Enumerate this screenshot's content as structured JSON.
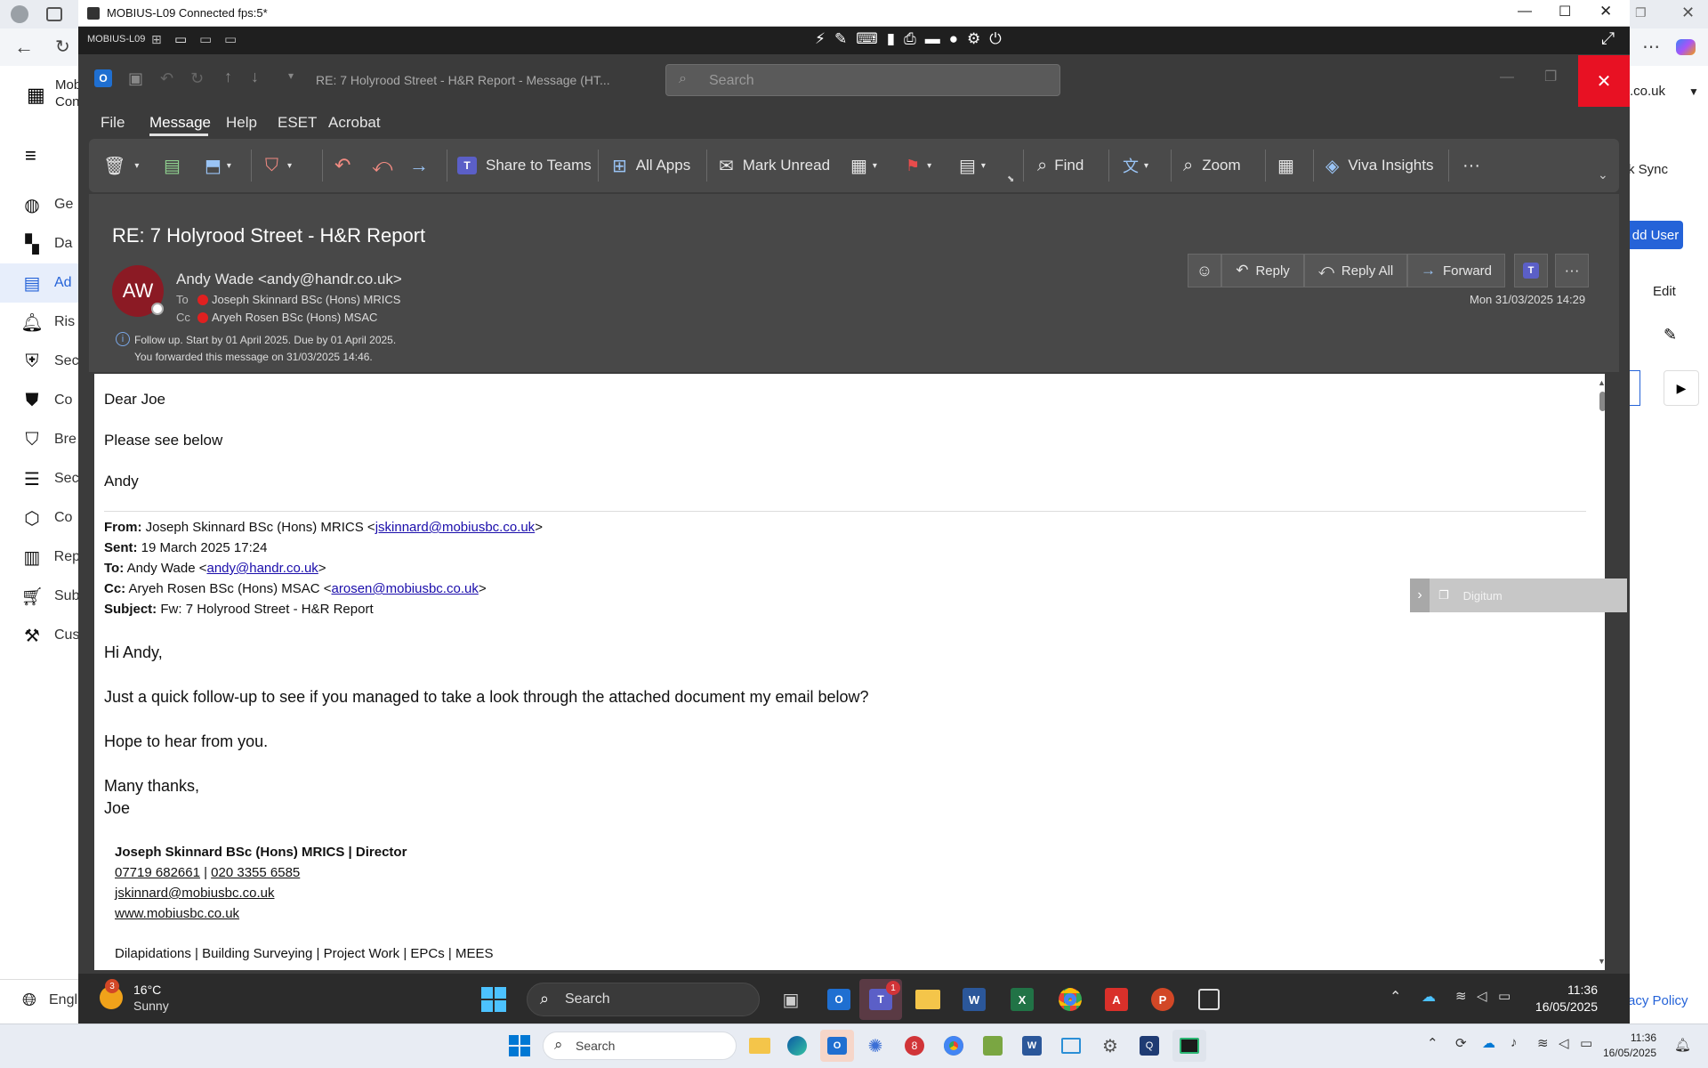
{
  "browser": {
    "visible_site_partial": ".co.uk",
    "sidebar": {
      "header_partial": [
        "Mob",
        "Con"
      ],
      "items": [
        {
          "label": "Ge",
          "icon": "globe-icon"
        },
        {
          "label": "Da",
          "icon": "dashboard-icon"
        },
        {
          "label": "Ad",
          "icon": "table-icon",
          "active": true
        },
        {
          "label": "Ris",
          "icon": "bell-icon"
        },
        {
          "label": "Sec",
          "icon": "shield-icon"
        },
        {
          "label": "Co",
          "icon": "shield-check-icon"
        },
        {
          "label": "Bre",
          "icon": "shield-alert-icon"
        },
        {
          "label": "Sec",
          "icon": "layers-icon"
        },
        {
          "label": "Co",
          "icon": "hexagon-icon"
        },
        {
          "label": "Rep",
          "icon": "report-icon"
        },
        {
          "label": "Sub",
          "icon": "cart-icon"
        },
        {
          "label": "Cus",
          "icon": "tools-icon"
        }
      ],
      "language": "Englis"
    },
    "right": {
      "sync_label": "k Sync",
      "add_user_label": "dd User",
      "edit_label": "Edit",
      "privacy_label": "acy Policy"
    }
  },
  "remote": {
    "window_title": "MOBIUS-L09 Connected fps:5*",
    "host_name": "MOBIUS-L09"
  },
  "outlook": {
    "title": "RE: 7 Holyrood Street - H&R Report  -  Message (HT...",
    "search_placeholder": "Search",
    "menu": [
      "File",
      "Message",
      "Help",
      "ESET",
      "Acrobat"
    ],
    "active_menu": "Message",
    "ribbon": {
      "share_teams": "Share to Teams",
      "all_apps": "All Apps",
      "mark_unread": "Mark Unread",
      "find": "Find",
      "zoom": "Zoom",
      "viva": "Viva Insights"
    },
    "message": {
      "subject": "RE: 7 Holyrood Street - H&R Report",
      "avatar_initials": "AW",
      "avatar_color": "#8b1a24",
      "sender": "Andy Wade <andy@handr.co.uk>",
      "to_label": "To",
      "to": "Joseph Skinnard BSc (Hons) MRICS",
      "cc_label": "Cc",
      "cc": "Aryeh Rosen BSc (Hons) MSAC",
      "info_line1": "Follow up.  Start by 01 April 2025.  Due by 01 April 2025.",
      "info_line2": "You forwarded this message on 31/03/2025 14:46.",
      "date": "Mon 31/03/2025 14:29",
      "actions": {
        "reply": "Reply",
        "reply_all": "Reply All",
        "forward": "Forward"
      }
    },
    "body": {
      "greeting": "Dear Joe",
      "line1": "Please see below",
      "signoff": "Andy",
      "quoted_header": {
        "from_label": "From:",
        "from_name": "Joseph Skinnard BSc (Hons) MRICS <",
        "from_email": "jskinnard@mobiusbc.co.uk",
        "from_close": ">",
        "sent_label": "Sent:",
        "sent": "19 March 2025 17:24",
        "to_label": "To:",
        "to_name": "Andy Wade <",
        "to_email": "andy@handr.co.uk",
        "to_close": ">",
        "cc_label": "Cc:",
        "cc_name": "Aryeh Rosen BSc (Hons) MSAC <",
        "cc_email": "arosen@mobiusbc.co.uk",
        "cc_close": ">",
        "subject_label": "Subject:",
        "subject": "Fw: 7 Holyrood Street - H&R Report"
      },
      "quoted": {
        "greeting": "Hi Andy,",
        "p1": "Just a quick follow-up to see if you managed to take a look through the attached document my email below?",
        "p2": "Hope to hear from you.",
        "thanks": "Many thanks,",
        "name": "Joe"
      },
      "signature": {
        "title": "Joseph Skinnard BSc (Hons) MRICS | Director",
        "phone1": "07719 682661",
        "sep": " | ",
        "phone2": "020 3355 6585",
        "email": "jskinnard@mobiusbc.co.uk",
        "web": "www.mobiusbc.co.uk",
        "services": "Dilapidations | Building Surveying | Project Work | EPCs | MEES"
      }
    },
    "digitum_label": "Digitum"
  },
  "remote_taskbar": {
    "weather_temp": "16°C",
    "weather_desc": "Sunny",
    "weather_badge": "3",
    "search": "Search",
    "teams_badge": "1",
    "time": "11:36",
    "date": "16/05/2025"
  },
  "host_taskbar": {
    "search": "Search",
    "time": "11:36",
    "date": "16/05/2025"
  }
}
